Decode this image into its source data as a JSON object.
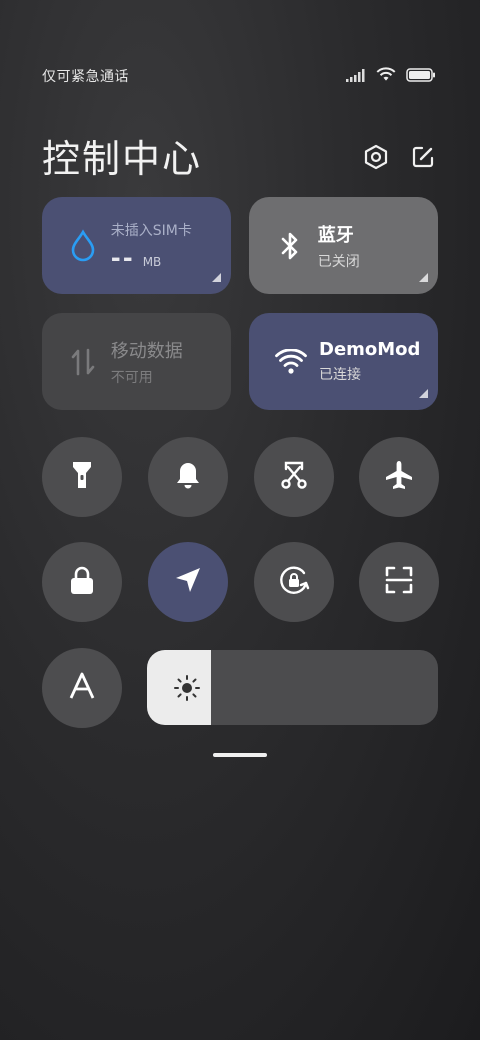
{
  "status": {
    "carrier_text": "仅可紧急通话"
  },
  "header": {
    "title": "控制中心"
  },
  "tiles": {
    "data_usage": {
      "label": "未插入SIM卡",
      "value": "--",
      "unit": "MB",
      "bg": "#4b5073",
      "icon": "water-drop-icon"
    },
    "bluetooth": {
      "label": "蓝牙",
      "status": "已关闭",
      "bg": "#6e6e70",
      "icon": "bluetooth-icon"
    },
    "mobile_data": {
      "label": "移动数据",
      "status": "不可用",
      "bg": "#454547",
      "icon": "mobile-data-icon"
    },
    "wifi": {
      "label": "DemoMod",
      "status": "已连接",
      "bg": "#4b5073",
      "icon": "wifi-icon"
    }
  },
  "toggles": [
    {
      "name": "flashlight",
      "icon": "flashlight-icon",
      "active": false
    },
    {
      "name": "mute",
      "icon": "bell-icon",
      "active": false
    },
    {
      "name": "screenshot",
      "icon": "scissors-icon",
      "active": false
    },
    {
      "name": "airplane-mode",
      "icon": "airplane-icon",
      "active": false
    },
    {
      "name": "lock-screen",
      "icon": "lock-icon",
      "active": false
    },
    {
      "name": "location",
      "icon": "location-arrow-icon",
      "active": true
    },
    {
      "name": "rotation-lock",
      "icon": "rotation-lock-icon",
      "active": false
    },
    {
      "name": "scanner",
      "icon": "scan-icon",
      "active": false
    },
    {
      "name": "auto-brightness",
      "icon": "font-a-icon",
      "active": false
    }
  ],
  "brightness": {
    "level": 0.22
  },
  "colors": {
    "accent": "#4b5073",
    "toggle_bg": "#4d4d4f"
  }
}
